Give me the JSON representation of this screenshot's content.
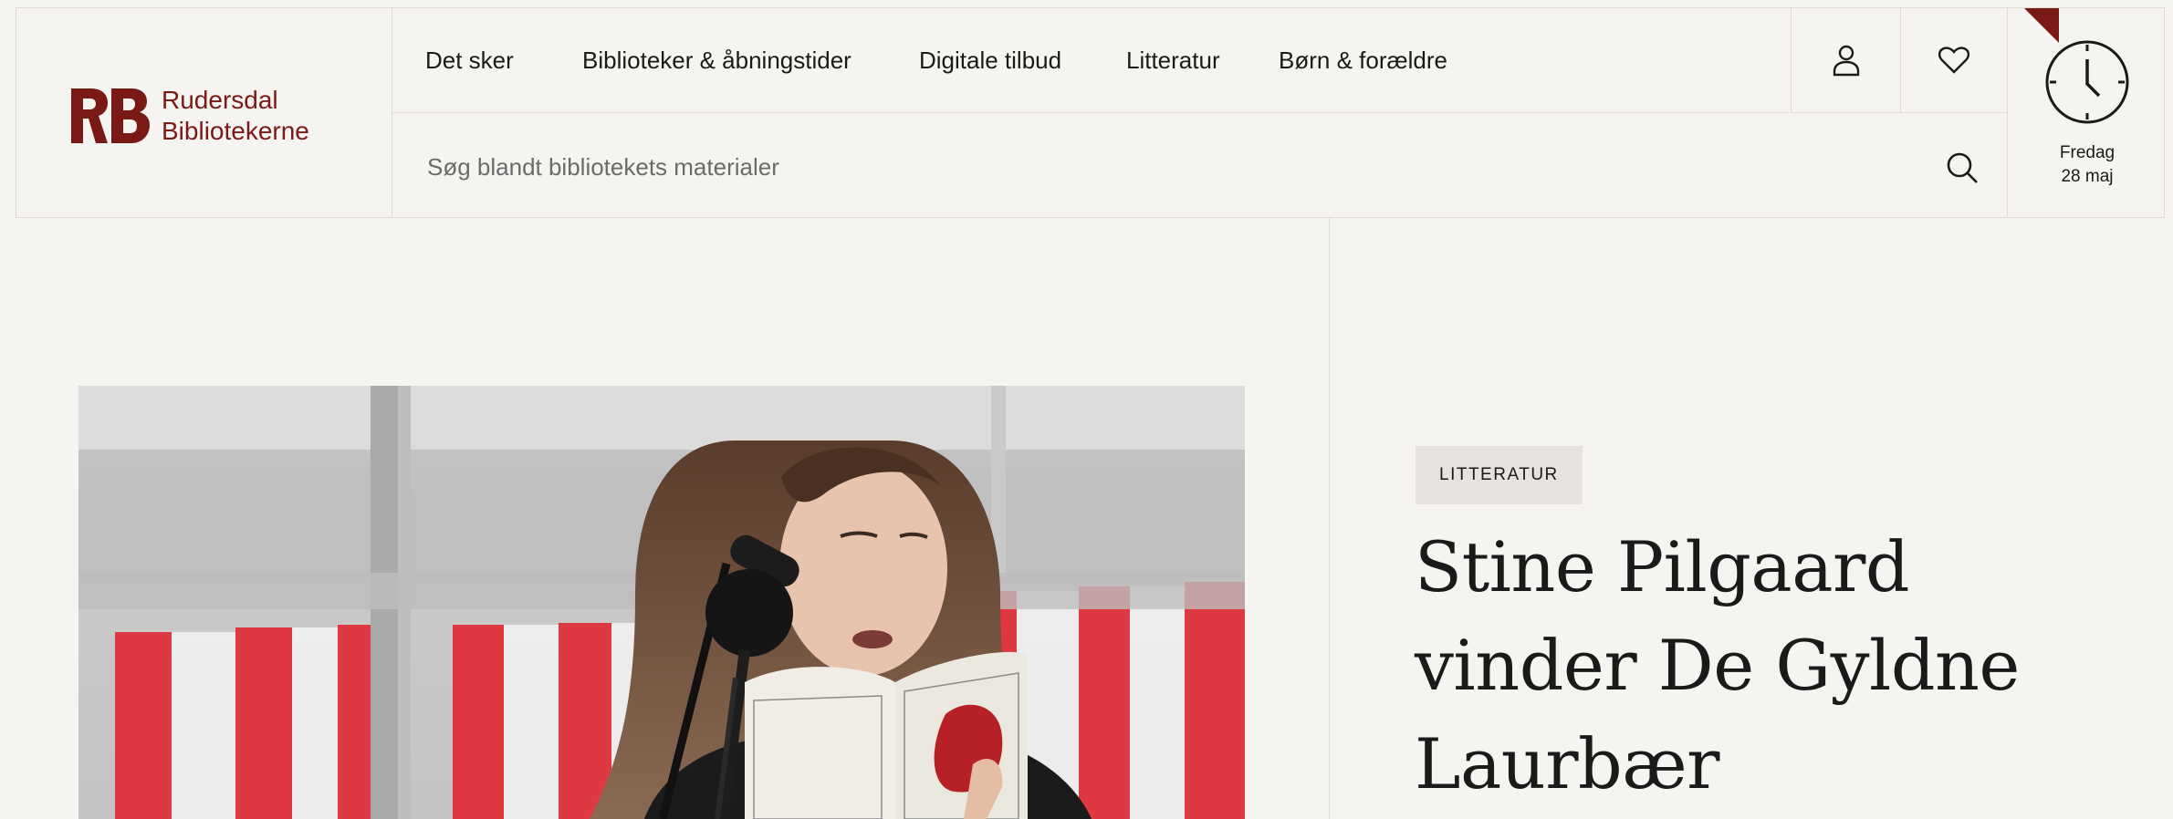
{
  "brand": {
    "name_line1": "Rudersdal",
    "name_line2": "Bibliotekerne",
    "logo_letters": "RB",
    "accent_color": "#7a1a17"
  },
  "nav": {
    "items": [
      {
        "label": "Det sker"
      },
      {
        "label": "Biblioteker & åbningstider"
      },
      {
        "label": "Digitale tilbud"
      },
      {
        "label": "Litteratur"
      },
      {
        "label": "Børn & forældre"
      }
    ]
  },
  "search": {
    "placeholder": "Søg blandt bibliotekets materialer"
  },
  "icons": {
    "user": "user-icon",
    "favorites": "heart-icon",
    "search": "search-icon",
    "clock": "clock-icon"
  },
  "opening": {
    "day": "Fredag",
    "date": "28 maj"
  },
  "article": {
    "category": "LITTERATUR",
    "title": "Stine Pilgaard vinder De Gyldne Laurbær"
  }
}
